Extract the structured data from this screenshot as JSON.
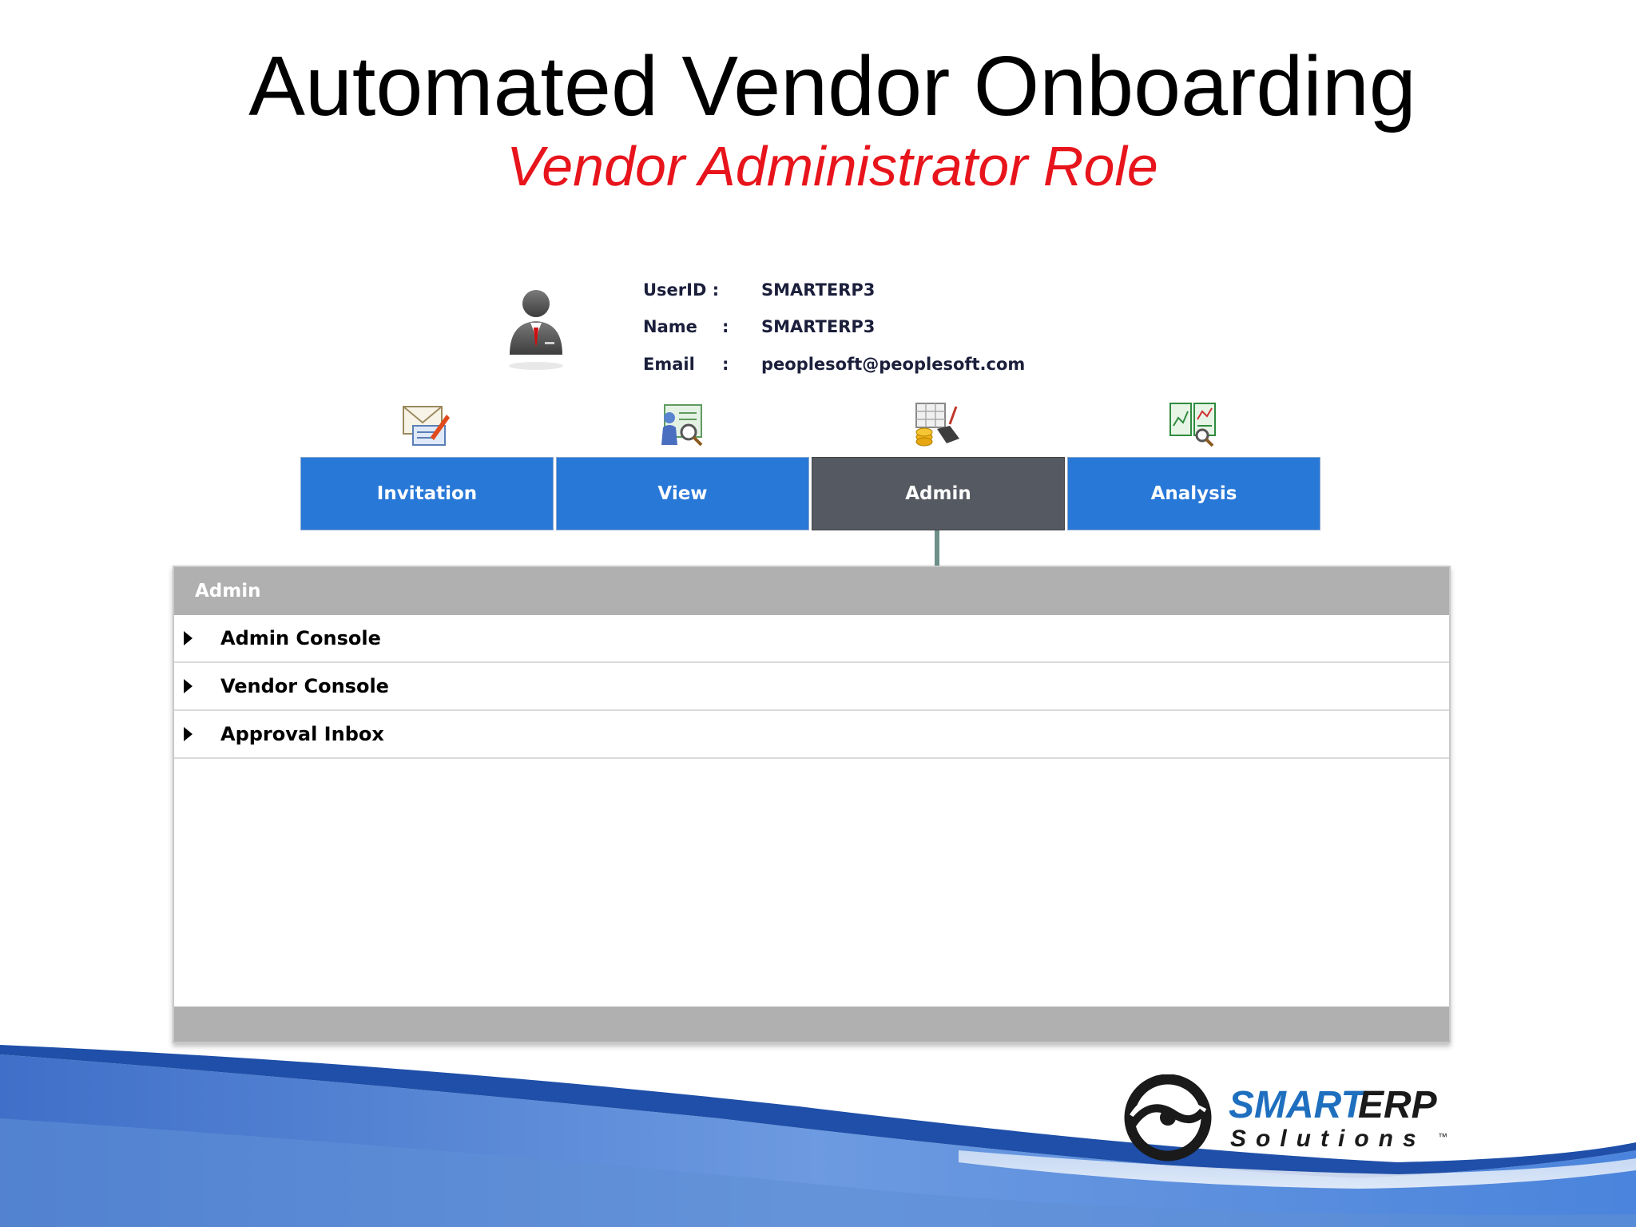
{
  "slide": {
    "title": "Automated Vendor Onboarding",
    "subtitle": "Vendor Administrator Role"
  },
  "user": {
    "userid_label": "UserID :",
    "userid_value": "SMARTERP3",
    "name_label": "Name",
    "name_value": "SMARTERP3",
    "email_label": "Email",
    "email_value": "peoplesoft@peoplesoft.com",
    "colon": ":"
  },
  "tabs": [
    {
      "label": "Invitation",
      "icon": "envelope-edit-icon"
    },
    {
      "label": "View",
      "icon": "person-search-icon"
    },
    {
      "label": "Admin",
      "icon": "admin-tools-icon",
      "active": true
    },
    {
      "label": "Analysis",
      "icon": "report-search-icon"
    }
  ],
  "panel": {
    "header": "Admin",
    "items": [
      {
        "label": "Admin Console"
      },
      {
        "label": "Vendor Console"
      },
      {
        "label": "Approval Inbox"
      }
    ]
  },
  "logo": {
    "line1_a": "SMART",
    "line1_b": "ERP",
    "line2": "Solutions",
    "tm": "™"
  },
  "colors": {
    "tab_blue": "#2878d8",
    "tab_active": "#555a62",
    "subtitle_red": "#e8141c",
    "logo_blue": "#1f6fbf"
  }
}
